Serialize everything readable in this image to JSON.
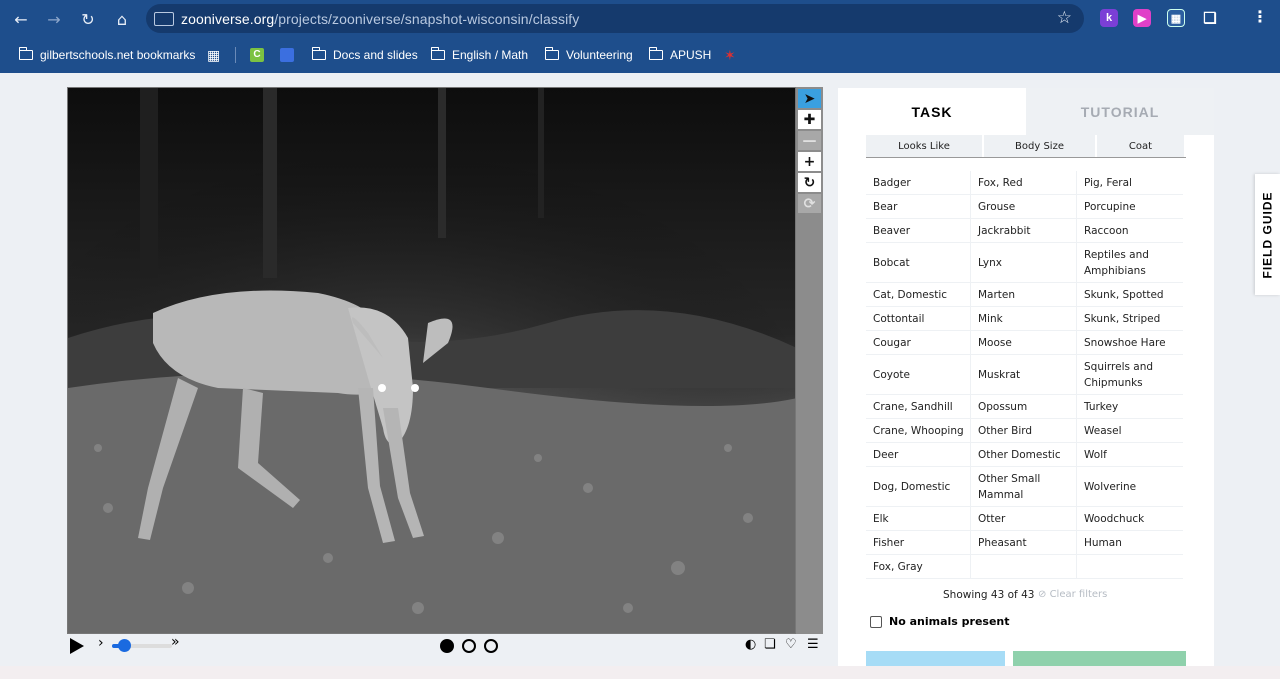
{
  "browser": {
    "url_host": "zooniverse.org",
    "url_path": "/projects/zooniverse/snapshot-wisconsin/classify",
    "bookmarks": [
      {
        "label": "gilbertschools.net bookmarks",
        "icon": "managed-folder-icon"
      },
      {
        "label": "Docs and slides",
        "icon": "folder-icon"
      },
      {
        "label": "English / Math",
        "icon": "folder-icon"
      },
      {
        "label": "Volunteering",
        "icon": "folder-icon"
      },
      {
        "label": "APUSH",
        "icon": "folder-icon"
      }
    ]
  },
  "tabs": {
    "task": "TASK",
    "tutorial": "TUTORIAL"
  },
  "filters": [
    "Looks Like",
    "Body Size",
    "Coat"
  ],
  "species_rows": [
    [
      "Badger",
      "Fox, Red",
      "Pig, Feral"
    ],
    [
      "Bear",
      "Grouse",
      "Porcupine"
    ],
    [
      "Beaver",
      "Jackrabbit",
      "Raccoon"
    ],
    [
      "Bobcat",
      "Lynx",
      "Reptiles and Amphibians"
    ],
    [
      "Cat, Domestic",
      "Marten",
      "Skunk, Spotted"
    ],
    [
      "Cottontail",
      "Mink",
      "Skunk, Striped"
    ],
    [
      "Cougar",
      "Moose",
      "Snowshoe Hare"
    ],
    [
      "Coyote",
      "Muskrat",
      "Squirrels and Chipmunks"
    ],
    [
      "Crane, Sandhill",
      "Opossum",
      "Turkey"
    ],
    [
      "Crane, Whooping",
      "Other Bird",
      "Weasel"
    ],
    [
      "Deer",
      "Other Domestic",
      "Wolf"
    ],
    [
      "Dog, Domestic",
      "Other Small Mammal",
      "Wolverine"
    ],
    [
      "Elk",
      "Otter",
      "Woodchuck"
    ],
    [
      "Fisher",
      "Pheasant",
      "Human"
    ],
    [
      "Fox, Gray",
      "",
      ""
    ]
  ],
  "showing_text": "Showing 43 of 43",
  "clear_filters": "Clear filters",
  "no_animals_label": "No animals present",
  "field_guide": "FIELD GUIDE",
  "player": {
    "frames": 3,
    "current_frame": 1,
    "speed_fraction": 0.2
  },
  "colors": {
    "chrome": "#1e4e8c",
    "accent_blue": "#a6dcf6",
    "accent_green": "#8fd1ac",
    "active_tool": "#3aa0e0"
  }
}
